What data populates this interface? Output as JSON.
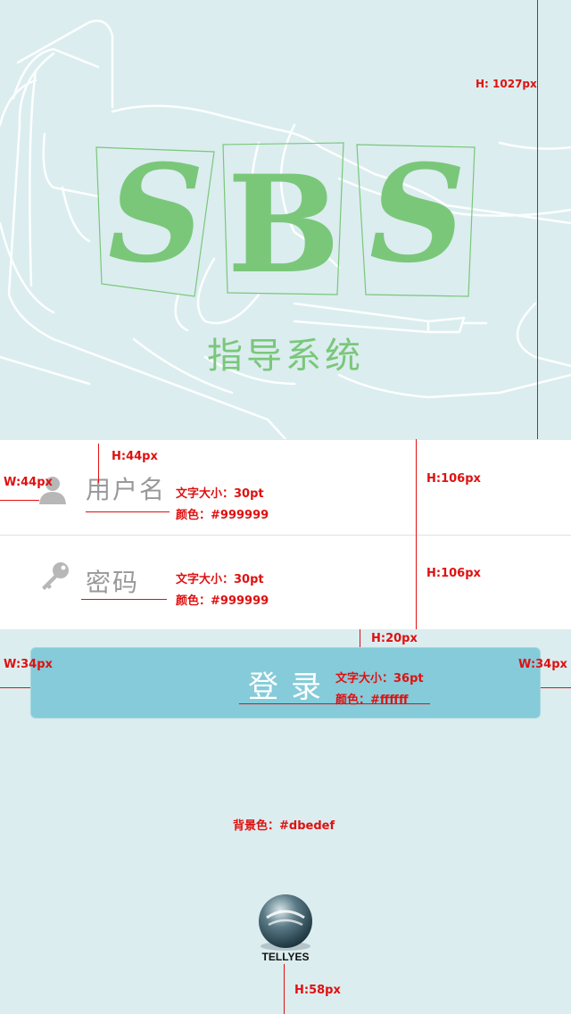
{
  "colors": {
    "background": "#dbedef",
    "panel": "#ffffff",
    "button": "#85cbd9",
    "placeholder": "#999999",
    "annotation": "#e01010",
    "logo_green": "#7ac77a"
  },
  "hero": {
    "logo_letters": [
      "S",
      "B",
      "S"
    ],
    "subtitle": "指导系统"
  },
  "form": {
    "username": {
      "label": "用户名",
      "icon": "user-icon",
      "size_note": "文字大小：30pt",
      "color_note": "颜色：#999999"
    },
    "password": {
      "label": "密码",
      "icon": "key-icon",
      "size_note": "文字大小：30pt",
      "color_note": "颜色：#999999"
    }
  },
  "login_button": {
    "label": "登录",
    "size_note": "文字大小：36pt",
    "color_note": "颜色：#ffffff"
  },
  "bg_note": "背景色：#dbedef",
  "brand": {
    "name": "TELLYES"
  },
  "annotations": {
    "hero_height": "H: 1027px",
    "icon_height": "H:44px",
    "icon_width": "W:44px",
    "username_row_height": "H:106px",
    "password_row_height": "H:106px",
    "gap_height": "H:20px",
    "btn_left_margin": "W:34px",
    "btn_right_margin": "W:34px",
    "logo_bottom": "H:58px"
  }
}
